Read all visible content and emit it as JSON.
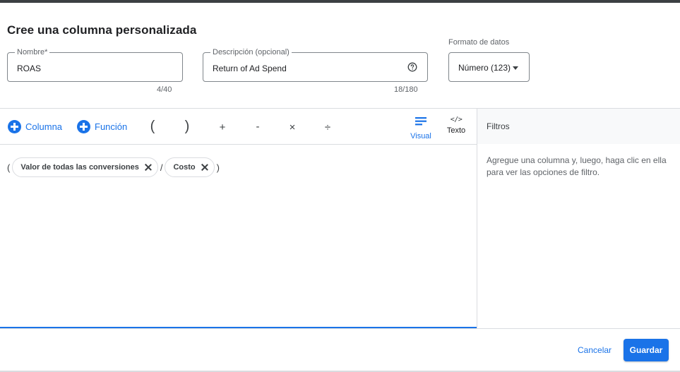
{
  "dialog": {
    "title": "Cree una columna personalizada"
  },
  "name_field": {
    "label": "Nombre*",
    "value": "ROAS",
    "counter": "4/40"
  },
  "description_field": {
    "label": "Descripción (opcional)",
    "value": "Return of Ad Spend",
    "counter": "18/180",
    "help_icon": "help-circle-icon"
  },
  "format": {
    "label": "Formato de datos",
    "selected": "Número (123)"
  },
  "toolbar": {
    "column_label": "Columna",
    "function_label": "Función",
    "open_paren": "(",
    "close_paren": ")",
    "plus": "+",
    "minus": "-",
    "times": "×",
    "divide": "÷",
    "visual_label": "Visual",
    "text_label": "Texto",
    "code_glyph": "</>"
  },
  "expression": {
    "open": "(",
    "chip1": "Valor de todas las conversiones",
    "operator": "/",
    "chip2": "Costo",
    "close": ")"
  },
  "filters": {
    "title": "Filtros",
    "help": "Agregue una columna y, luego, haga clic en ella para ver las opciones de filtro."
  },
  "footer": {
    "cancel": "Cancelar",
    "save": "Guardar"
  },
  "colors": {
    "accent": "#1a73e8",
    "text": "#202124",
    "border": "#dadce0"
  }
}
